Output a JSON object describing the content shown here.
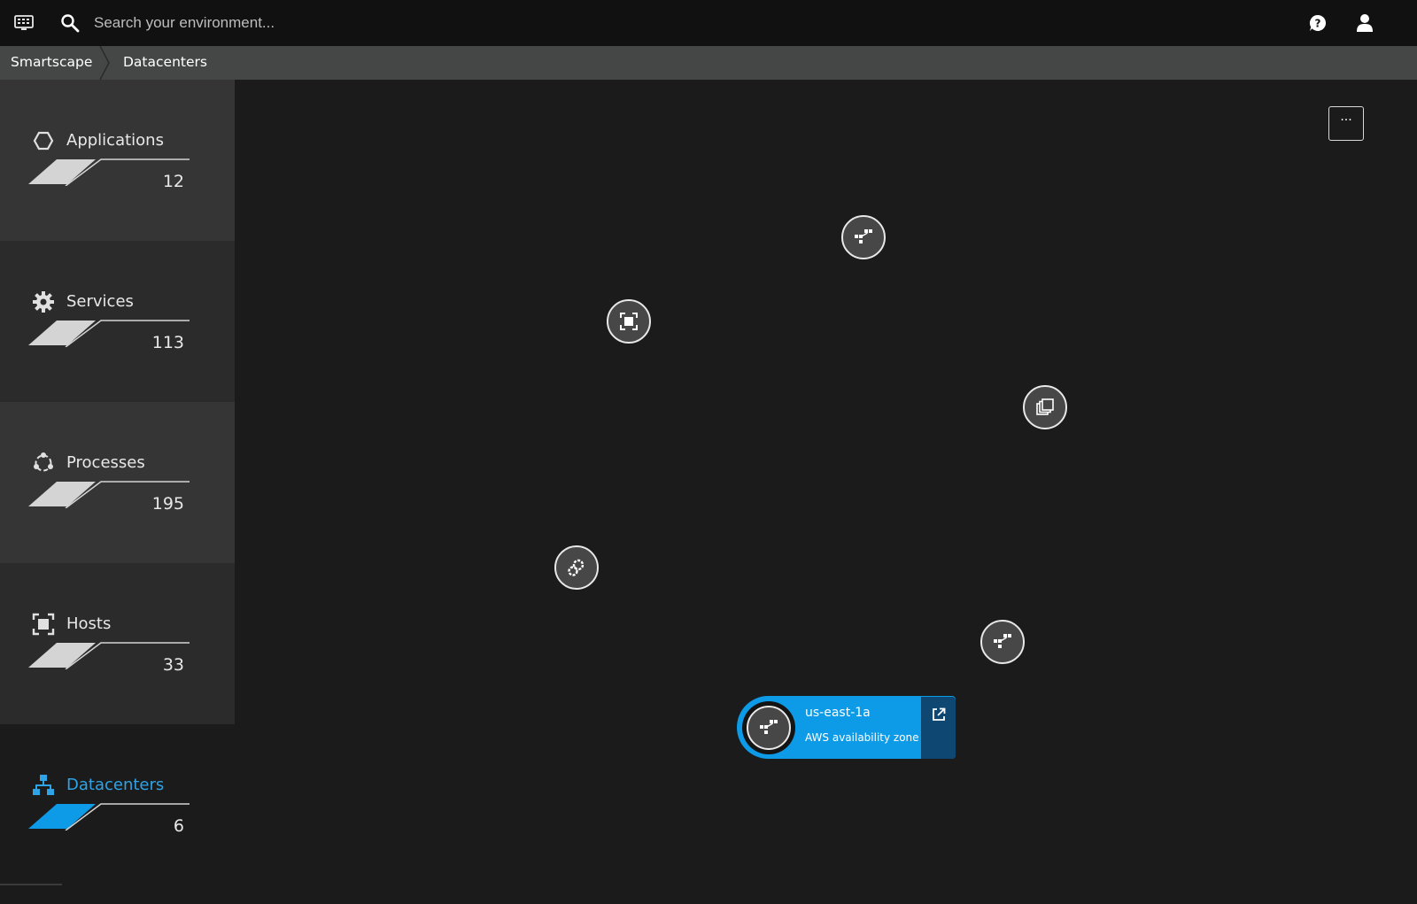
{
  "topbar": {
    "search_placeholder": "Search your environment..."
  },
  "breadcrumb": {
    "items": [
      "Smartscape",
      "Datacenters"
    ]
  },
  "sidebar": {
    "items": [
      {
        "label": "Applications",
        "count": "12",
        "icon": "hexagon-icon"
      },
      {
        "label": "Services",
        "count": "113",
        "icon": "gear-icon"
      },
      {
        "label": "Processes",
        "count": "195",
        "icon": "process-ring-icon"
      },
      {
        "label": "Hosts",
        "count": "33",
        "icon": "host-icon"
      },
      {
        "label": "Datacenters",
        "count": "6",
        "icon": "network-icon",
        "active": true
      }
    ]
  },
  "canvas": {
    "more_label": "···",
    "nodes": [
      {
        "icon": "datacenter-icon"
      },
      {
        "icon": "host-icon"
      },
      {
        "icon": "layers-icon"
      },
      {
        "icon": "process-group-icon"
      },
      {
        "icon": "datacenter-icon"
      }
    ],
    "selected": {
      "title": "us-east-1a",
      "subtitle": "AWS availability zone",
      "icon": "datacenter-icon"
    }
  },
  "colors": {
    "accent": "#0d9ae6",
    "accent_dark": "#0f4773",
    "background": "#1b1b1b"
  }
}
